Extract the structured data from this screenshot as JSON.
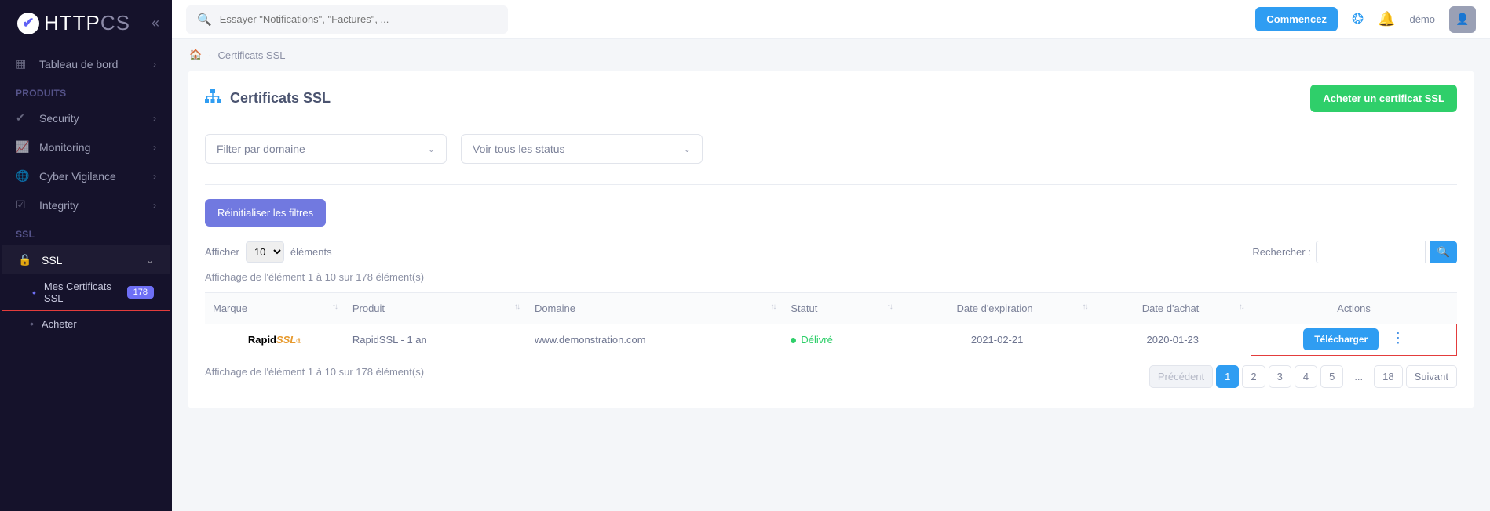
{
  "brand": {
    "http": "HTTP",
    "cs": "CS"
  },
  "search": {
    "placeholder": "Essayer \"Notifications\", \"Factures\", ..."
  },
  "topbar": {
    "start": "Commencez",
    "user": "démo"
  },
  "sidebar": {
    "dashboard": "Tableau de bord",
    "section_products": "PRODUITS",
    "security": "Security",
    "monitoring": "Monitoring",
    "cyber": "Cyber Vigilance",
    "integrity": "Integrity",
    "section_ssl": "SSL",
    "ssl": "SSL",
    "my_certs": "Mes Certificats SSL",
    "my_certs_badge": "178",
    "buy": "Acheter"
  },
  "breadcrumb": {
    "current": "Certificats SSL"
  },
  "page": {
    "title": "Certificats SSL",
    "buy_button": "Acheter un certificat SSL",
    "filter_domain": "Filter par domaine",
    "filter_status": "Voir tous les status",
    "reset_filters": "Réinitialiser les filtres",
    "show_label": "Afficher",
    "show_value": "10",
    "entries_label": "éléments",
    "search_label": "Rechercher :",
    "range_info": "Affichage de l'élément 1 à 10 sur 178 élément(s)"
  },
  "table": {
    "headers": {
      "brand": "Marque",
      "product": "Produit",
      "domain": "Domaine",
      "status": "Statut",
      "expiration": "Date d'expiration",
      "purchase": "Date d'achat",
      "actions": "Actions"
    },
    "rows": [
      {
        "brand_prefix": "Rapid",
        "brand_suffix": "SSL",
        "brand_dot": "®",
        "product": "RapidSSL - 1 an",
        "domain": "www.demonstration.com",
        "status": "Délivré",
        "expiration": "2021-02-21",
        "purchase": "2020-01-23",
        "download": "Télécharger"
      }
    ]
  },
  "pagination": {
    "prev": "Précédent",
    "next": "Suivant",
    "pages": [
      "1",
      "2",
      "3",
      "4",
      "5"
    ],
    "ellipsis": "...",
    "last": "18"
  }
}
